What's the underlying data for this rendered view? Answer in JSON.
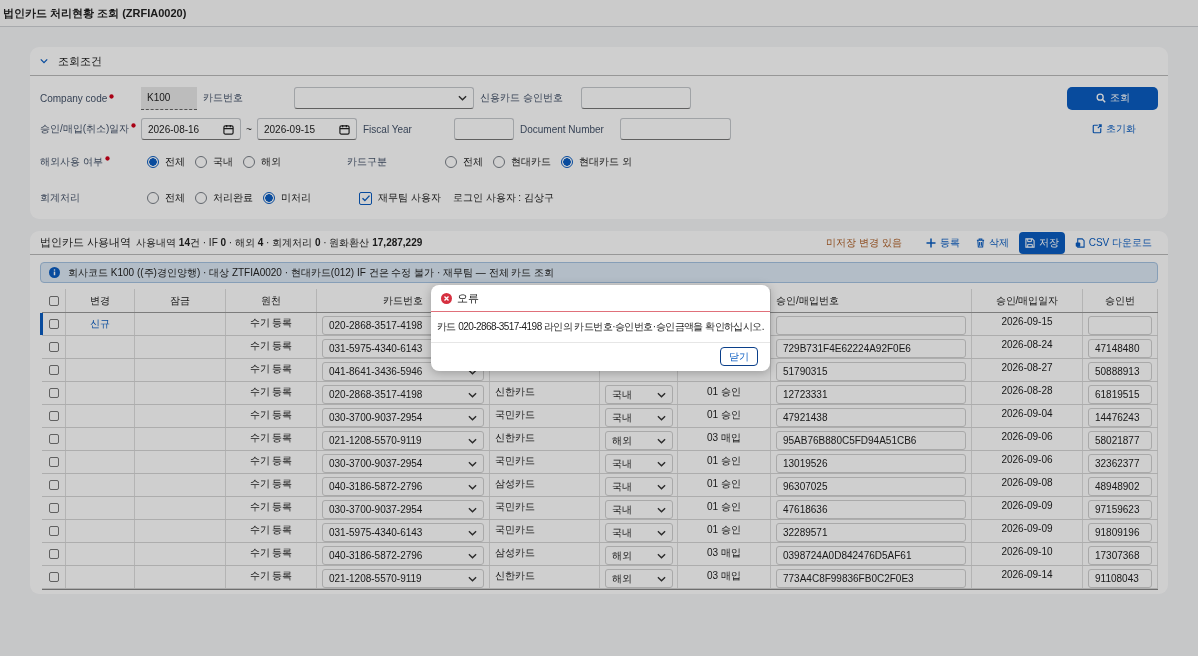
{
  "window": {
    "title": "법인카드 처리현황 조회 (ZRFIA0020)"
  },
  "filters": {
    "title": "조회조건",
    "expanded": true,
    "company_code": {
      "label": "Company code",
      "required": true,
      "value": "K100"
    },
    "card_number": {
      "label": "카드번호"
    },
    "approval_no": {
      "label": "신용카드 승인번호"
    },
    "date": {
      "label": "승인/매입(취소)일자",
      "required": true,
      "from": "2026-08-16",
      "separator": "~",
      "to": "2026-09-15"
    },
    "fiscal_year": {
      "label": "Fiscal Year"
    },
    "document_number": {
      "label": "Document Number"
    },
    "overseas": {
      "label": "해외사용 여부",
      "required": true,
      "options": [
        {
          "label": "전체",
          "selected": true
        },
        {
          "label": "국내",
          "selected": false
        },
        {
          "label": "해외",
          "selected": false
        }
      ]
    },
    "card_type": {
      "label": "카드구분",
      "required": false,
      "options": [
        {
          "label": "전체",
          "selected": false
        },
        {
          "label": "현대카드",
          "selected": false
        },
        {
          "label": "현대카드 외",
          "selected": true
        }
      ]
    },
    "accounting": {
      "label": "회계처리",
      "required": false,
      "options": [
        {
          "label": "전체",
          "selected": false
        },
        {
          "label": "처리완료",
          "selected": false
        },
        {
          "label": "미처리",
          "selected": true
        }
      ]
    },
    "finance_team": {
      "label": "재무팀 사용자",
      "checked": true
    },
    "login_user": "로그인 사용자 : 김상구",
    "search_button": "조회",
    "reset_button": "초기화"
  },
  "list": {
    "title": "법인카드 사용내역",
    "summary": "사용내역 **14**건 · IF **0** · 해외 **4** · 회계처리 **0** · 원화환산 **17,287,229**",
    "unsaved_notice": "미저장 변경 있음",
    "actions": [
      {
        "kind": "add",
        "label": "등록",
        "selected": false
      },
      {
        "kind": "delete",
        "label": "삭제",
        "selected": false
      },
      {
        "kind": "save",
        "label": "저장",
        "selected": true
      },
      {
        "kind": "csv",
        "label": "CSV 다운로드",
        "selected": false
      }
    ],
    "info_banner": "회사코드 K100 ((주)경인양행) · 대상 ZTFIA0020 · 현대카드(012) IF 건은 수정 불가 · 재무팀 — 전체 카드 조회",
    "select_all": false,
    "columns": [
      "변경",
      "잠금",
      "원천",
      "카드번호",
      "승인/매입번호",
      "승인/매입일자",
      "승인번"
    ],
    "rows": [
      {
        "checked": false,
        "marked": true,
        "change": "신규",
        "source": "수기 등록",
        "card_number": "020-2868-3517-4198",
        "date": "2026-09-15"
      },
      {
        "checked": false,
        "marked": false,
        "source": "수기 등록",
        "card_number": "031-5975-4340-6143",
        "ref_no": "729B731F4E62224A92F0E6",
        "date": "2026-08-24",
        "approval_no": "47148480"
      },
      {
        "checked": false,
        "marked": false,
        "source": "수기 등록",
        "card_number": "041-8641-3436-5946",
        "ref_no": "51790315",
        "date": "2026-08-27",
        "approval_no": "50888913"
      },
      {
        "checked": false,
        "marked": false,
        "source": "수기 등록",
        "card_number": "020-2868-3517-4198",
        "issuer": "신한카드",
        "region": "국내",
        "type": "01 승인",
        "ref_no": "12723331",
        "date": "2026-08-28",
        "approval_no": "61819515"
      },
      {
        "checked": false,
        "marked": false,
        "source": "수기 등록",
        "card_number": "030-3700-9037-2954",
        "issuer": "국민카드",
        "region": "국내",
        "type": "01 승인",
        "ref_no": "47921438",
        "date": "2026-09-04",
        "approval_no": "14476243"
      },
      {
        "checked": false,
        "marked": false,
        "source": "수기 등록",
        "card_number": "021-1208-5570-9119",
        "issuer": "신한카드",
        "region": "해외",
        "type": "03 매입",
        "ref_no": "95AB76B880C5FD94A51CB6",
        "date": "2026-09-06",
        "approval_no": "58021877"
      },
      {
        "checked": false,
        "marked": false,
        "source": "수기 등록",
        "card_number": "030-3700-9037-2954",
        "issuer": "국민카드",
        "region": "국내",
        "type": "01 승인",
        "ref_no": "13019526",
        "date": "2026-09-06",
        "approval_no": "32362377"
      },
      {
        "checked": false,
        "marked": false,
        "source": "수기 등록",
        "card_number": "040-3186-5872-2796",
        "issuer": "삼성카드",
        "region": "국내",
        "type": "01 승인",
        "ref_no": "96307025",
        "date": "2026-09-08",
        "approval_no": "48948902"
      },
      {
        "checked": false,
        "marked": false,
        "source": "수기 등록",
        "card_number": "030-3700-9037-2954",
        "issuer": "국민카드",
        "region": "국내",
        "type": "01 승인",
        "ref_no": "47618636",
        "date": "2026-09-09",
        "approval_no": "97159623"
      },
      {
        "checked": false,
        "marked": false,
        "source": "수기 등록",
        "card_number": "031-5975-4340-6143",
        "issuer": "국민카드",
        "region": "국내",
        "type": "01 승인",
        "ref_no": "32289571",
        "date": "2026-09-09",
        "approval_no": "91809196"
      },
      {
        "checked": false,
        "marked": false,
        "source": "수기 등록",
        "card_number": "040-3186-5872-2796",
        "issuer": "삼성카드",
        "region": "해외",
        "type": "03 매입",
        "ref_no": "0398724A0D842476D5AF61",
        "date": "2026-09-10",
        "approval_no": "17307368"
      },
      {
        "checked": false,
        "marked": false,
        "source": "수기 등록",
        "card_number": "021-1208-5570-9119",
        "issuer": "신한카드",
        "region": "해외",
        "type": "03 매입",
        "ref_no": "773A4C8F99836FB0C2F0E3",
        "date": "2026-09-14",
        "approval_no": "91108043"
      }
    ]
  },
  "dialog": {
    "kind": "error",
    "title": "오류",
    "message": "카드 020-2868-3517-4198 라인의 카드번호·승인번호·승인금액을 확인하십시오.",
    "close_button": "닫기"
  }
}
